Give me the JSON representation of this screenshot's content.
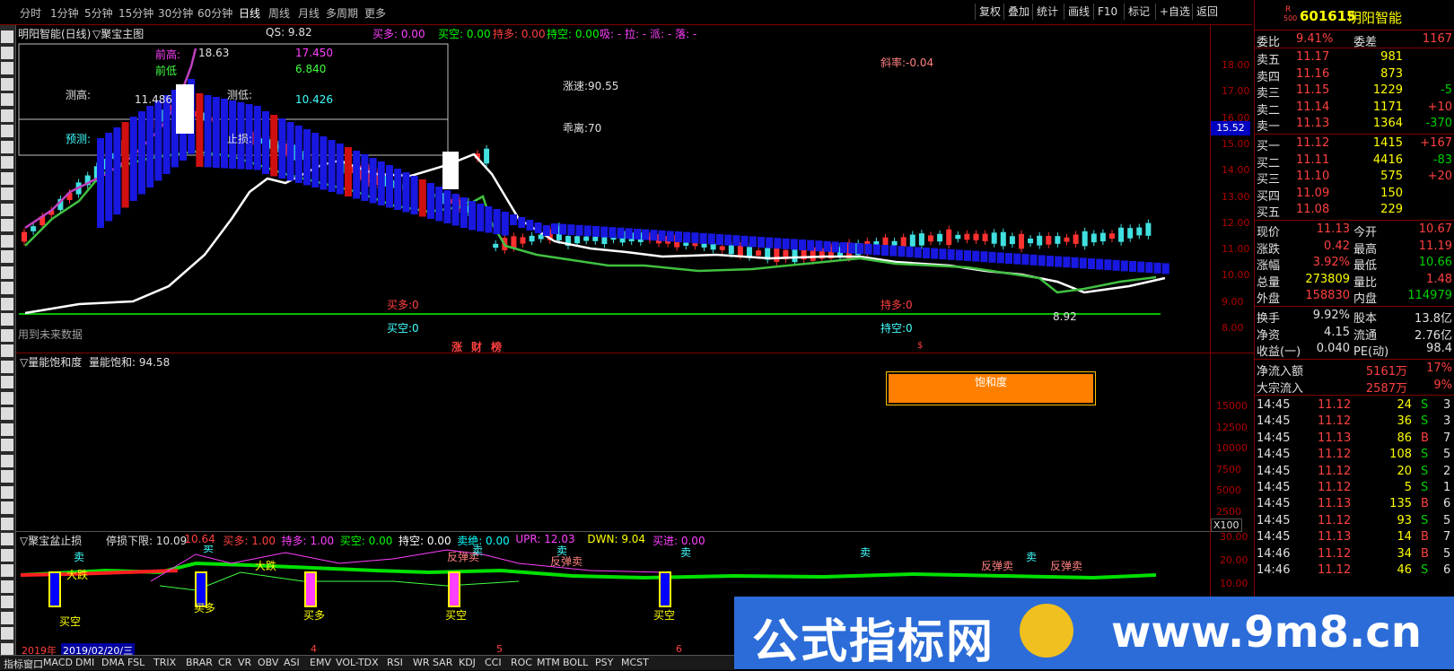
{
  "toolbar": {
    "periods": [
      "分时",
      "1分钟",
      "5分钟",
      "15分钟",
      "30分钟",
      "60分钟",
      "日线",
      "周线",
      "月线",
      "多周期",
      "更多"
    ],
    "right_buttons": [
      "复权",
      "叠加",
      "统计",
      "画线",
      "F10",
      "标记",
      "+自选",
      "返回"
    ]
  },
  "main_chart": {
    "title": "明阳智能(日线)",
    "indicator": "▽聚宝主图",
    "qs": "QS: 9.82",
    "status": {
      "buy_long": "买多: 0.00",
      "buy_short": "买空: 0.00",
      "hold_long": "持多: 0.00",
      "hold_short": "持空: 0.00",
      "tail": "吸: - 拉: - 派: - 落: -"
    },
    "box": {
      "prev_high_label": "前高:",
      "prev_low_label": "前低",
      "prev_high_val": "17.450",
      "prev_low_val": "6.840",
      "measure_high": "测高:",
      "measure_low": "测低:",
      "measure_high_val": "11.486",
      "measure_low_val": "10.426",
      "forecast": "预测:",
      "stop": "止损:"
    },
    "peak_price": "18.63",
    "slope": "斜率:-0.04",
    "speed": "涨速:90.55",
    "deviation": "乖离:70",
    "low_price": "8.92",
    "buy_long_left": "买多:0",
    "buy_short_left": "买空:0",
    "hold_long_right": "持多:0",
    "hold_short_right": "持空:0",
    "future_note": "用到未来数据",
    "markers": [
      "涨",
      "财",
      "榜"
    ],
    "marker_s": "$",
    "current_price_tag": "15.52",
    "y_ticks": [
      "18.00",
      "17.00",
      "16.00",
      "15.00",
      "14.00",
      "13.00",
      "12.00",
      "11.00",
      "10.00",
      "9.00",
      "8.00"
    ]
  },
  "volume_panel": {
    "title": "▽量能饱和度",
    "value": "量能饱和: 94.58",
    "box_label": "饱和度",
    "y_ticks": [
      "15000",
      "12500",
      "10000",
      "7500",
      "5000",
      "2500"
    ],
    "unit": "X100"
  },
  "bottom_panel": {
    "title": "▽聚宝盆止损",
    "stats": [
      {
        "t": "停损下限: 10.09",
        "c": "#e0e0e0"
      },
      {
        "t": "10.64",
        "c": "#ff4040"
      },
      {
        "t": "买多: 1.00",
        "c": "#ff4040"
      },
      {
        "t": "持多: 1.00",
        "c": "#ff40ff"
      },
      {
        "t": "买空: 0.00",
        "c": "#00ff00"
      },
      {
        "t": "持空: 0.00",
        "c": "#ffffff"
      },
      {
        "t": "卖绝: 0.00",
        "c": "#00ffff"
      },
      {
        "t": "UPR: 12.03",
        "c": "#ff40ff"
      },
      {
        "t": "DWN: 9.04",
        "c": "#ffff00"
      },
      {
        "t": "买进: 0.00",
        "c": "#ff40ff"
      }
    ],
    "labels": [
      "卖",
      "大跌",
      "卖",
      "大跌",
      "反弹卖",
      "卖",
      "卖",
      "反弹卖",
      "卖",
      "卖",
      "反弹卖",
      "卖",
      "反弹卖",
      "买空",
      "买多",
      "买多",
      "买空"
    ],
    "y_ticks": [
      "30.00",
      "20.00",
      "10.00"
    ]
  },
  "date_bar": {
    "year": "2019年",
    "date": "2019/02/20/三",
    "m4": "4",
    "m5": "5",
    "m6": "6"
  },
  "bottom_tabs": [
    "指标",
    "窗口",
    "MACD",
    "DMI",
    "DMA",
    "FSL",
    "TRIX",
    "BRAR",
    "CR",
    "VR",
    "OBV",
    "ASI",
    "EMV",
    "VOL-TDX",
    "RSI",
    "WR",
    "SAR",
    "KDJ",
    "CCI",
    "ROC",
    "MTM",
    "BOLL",
    "PSY",
    "MCST"
  ],
  "right_panel": {
    "code": "601615",
    "name": "明阳智能",
    "badge_r": "R",
    "badge_500": "500",
    "webi": {
      "label": "委比",
      "value": "9.41%",
      "diff_label": "委差",
      "diff": "1167"
    },
    "sells": [
      {
        "label": "卖五",
        "price": "11.17",
        "vol": "981",
        "chg": ""
      },
      {
        "label": "卖四",
        "price": "11.16",
        "vol": "873",
        "chg": ""
      },
      {
        "label": "卖三",
        "price": "11.15",
        "vol": "1229",
        "chg": "-5"
      },
      {
        "label": "卖二",
        "price": "11.14",
        "vol": "1171",
        "chg": "+10"
      },
      {
        "label": "卖一",
        "price": "11.13",
        "vol": "1364",
        "chg": "-370"
      }
    ],
    "buys": [
      {
        "label": "买一",
        "price": "11.12",
        "vol": "1415",
        "chg": "+167"
      },
      {
        "label": "买二",
        "price": "11.11",
        "vol": "4416",
        "chg": "-83"
      },
      {
        "label": "买三",
        "price": "11.10",
        "vol": "575",
        "chg": "+20"
      },
      {
        "label": "买四",
        "price": "11.09",
        "vol": "150",
        "chg": ""
      },
      {
        "label": "买五",
        "price": "11.08",
        "vol": "229",
        "chg": ""
      }
    ],
    "quote": [
      {
        "l1": "现价",
        "v1": "11.13",
        "l2": "今开",
        "v2": "10.67"
      },
      {
        "l1": "涨跌",
        "v1": "0.42",
        "l2": "最高",
        "v2": "11.19"
      },
      {
        "l1": "涨幅",
        "v1": "3.92%",
        "l2": "最低",
        "v2": "10.66"
      },
      {
        "l1": "总量",
        "v1": "273809",
        "l2": "量比",
        "v2": "1.48"
      },
      {
        "l1": "外盘",
        "v1": "158830",
        "l2": "内盘",
        "v2": "114979"
      }
    ],
    "fund": [
      {
        "l1": "换手",
        "v1": "9.92%",
        "l2": "股本",
        "v2": "13.8亿"
      },
      {
        "l1": "净资",
        "v1": "4.15",
        "l2": "流通",
        "v2": "2.76亿"
      },
      {
        "l1": "收益(一)",
        "v1": "0.040",
        "l2": "PE(动)",
        "v2": "98.4"
      }
    ],
    "flow": [
      {
        "l": "净流入额",
        "v": "5161万",
        "p": "17%"
      },
      {
        "l": "大宗流入",
        "v": "2587万",
        "p": "9%"
      }
    ],
    "ticks": [
      {
        "t": "14:45",
        "p": "11.12",
        "v": "24",
        "d": "S",
        "n": "3"
      },
      {
        "t": "14:45",
        "p": "11.12",
        "v": "36",
        "d": "S",
        "n": "3"
      },
      {
        "t": "14:45",
        "p": "11.13",
        "v": "86",
        "d": "B",
        "n": "7"
      },
      {
        "t": "14:45",
        "p": "11.12",
        "v": "108",
        "d": "S",
        "n": "5"
      },
      {
        "t": "14:45",
        "p": "11.12",
        "v": "20",
        "d": "S",
        "n": "2"
      },
      {
        "t": "14:45",
        "p": "11.12",
        "v": "5",
        "d": "S",
        "n": "1"
      },
      {
        "t": "14:45",
        "p": "11.13",
        "v": "135",
        "d": "B",
        "n": "6"
      },
      {
        "t": "14:45",
        "p": "11.12",
        "v": "93",
        "d": "S",
        "n": "5"
      },
      {
        "t": "14:45",
        "p": "11.13",
        "v": "14",
        "d": "B",
        "n": "7"
      },
      {
        "t": "14:46",
        "p": "11.12",
        "v": "34",
        "d": "B",
        "n": "5"
      },
      {
        "t": "14:46",
        "p": "11.12",
        "v": "46",
        "d": "S",
        "n": "6"
      }
    ]
  },
  "watermark": {
    "text": "公式指标网",
    "url": "www.9m8.cn"
  }
}
